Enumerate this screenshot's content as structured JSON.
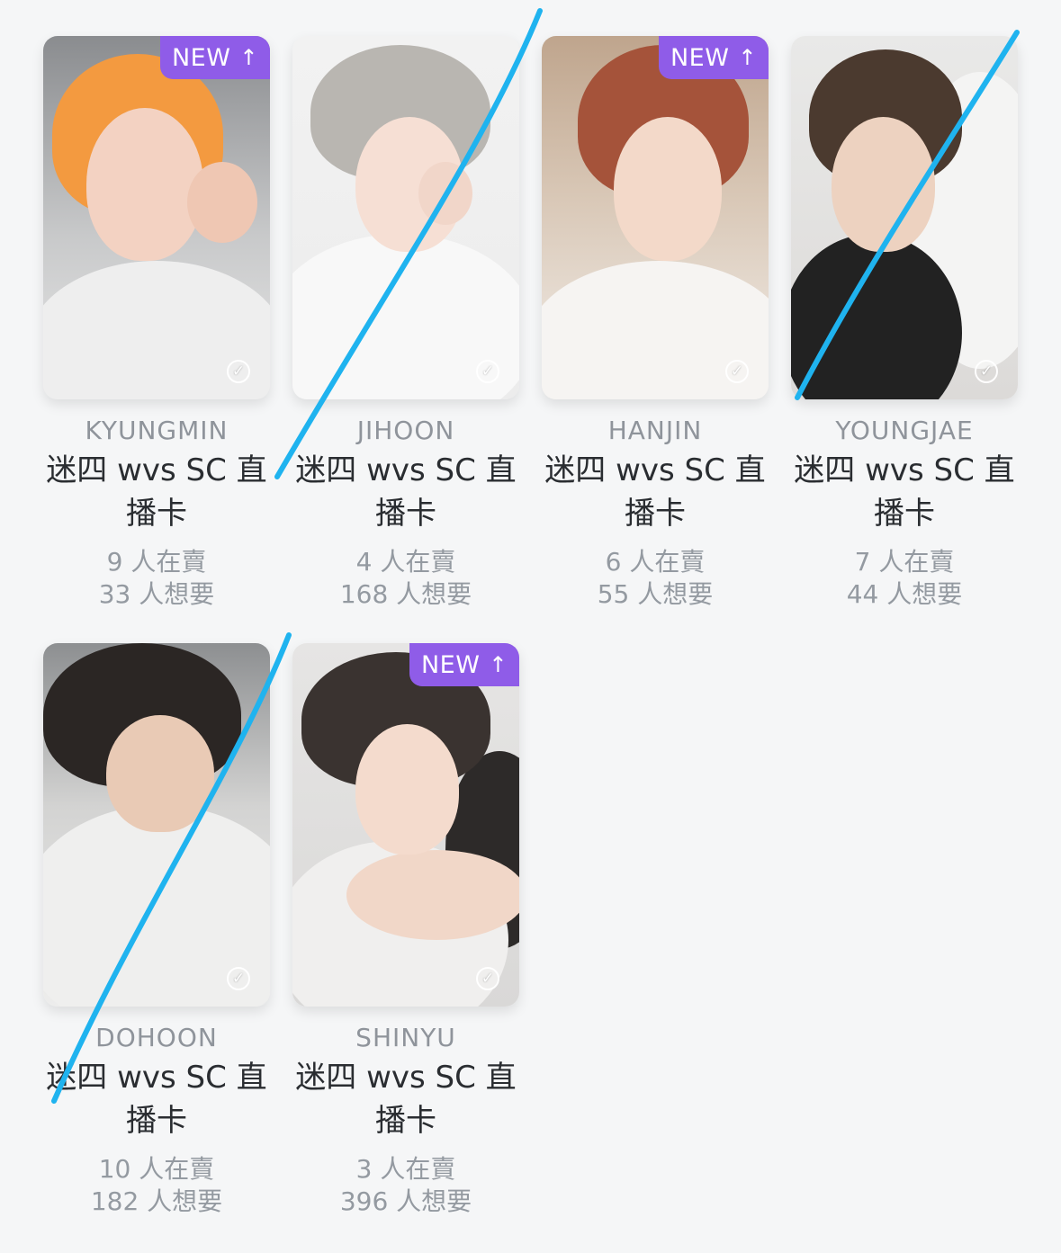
{
  "badge_label": "NEW",
  "cards": [
    {
      "name": "KYUNGMIN",
      "title": "迷四 wvs SC 直播卡",
      "sellers": "9 人在賣",
      "wants": "33 人想要",
      "is_new": true
    },
    {
      "name": "JIHOON",
      "title": "迷四 wvs SC 直播卡",
      "sellers": "4 人在賣",
      "wants": "168 人想要",
      "is_new": false
    },
    {
      "name": "HANJIN",
      "title": "迷四 wvs SC 直播卡",
      "sellers": "6 人在賣",
      "wants": "55 人想要",
      "is_new": true
    },
    {
      "name": "YOUNGJAE",
      "title": "迷四 wvs SC 直播卡",
      "sellers": "7 人在賣",
      "wants": "44 人想要",
      "is_new": false
    },
    {
      "name": "DOHOON",
      "title": "迷四 wvs SC 直播卡",
      "sellers": "10 人在賣",
      "wants": "182 人想要",
      "is_new": false
    },
    {
      "name": "SHINYU",
      "title": "迷四 wvs SC 直播卡",
      "sellers": "3 人在賣",
      "wants": "396 人想要",
      "is_new": true
    }
  ],
  "colors": {
    "badge": "#8f5ce8",
    "strike": "#1fb3ef",
    "background": "#f5f6f7"
  },
  "icons": {
    "badge_arrow": "arrow-up-icon",
    "photo_check": "check-circle-icon"
  }
}
